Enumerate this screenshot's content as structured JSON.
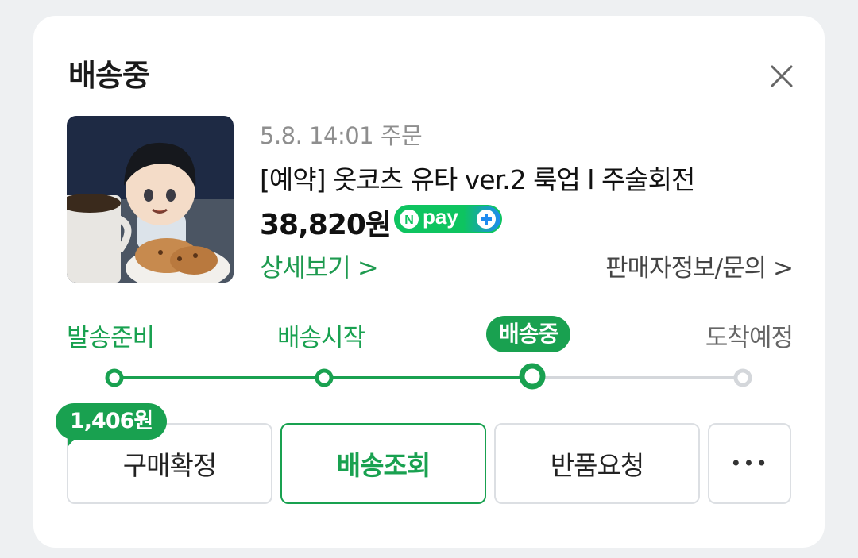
{
  "card": {
    "title": "배송중",
    "close_icon": "close-icon"
  },
  "product": {
    "image_description_icon": "product-thumbnail",
    "order_date": "5.8. 14:01 주문",
    "name": "[예약] 옷코츠 유타 ver.2 룩업 l 주술회전",
    "price": "38,820원",
    "npay_label": "pay"
  },
  "links": {
    "detail": "상세보기 >",
    "seller": "판매자정보/문의 >"
  },
  "progress": {
    "steps": [
      "발송준비",
      "배송시작",
      "배송중",
      "도착예정"
    ],
    "current_index": 2,
    "colors": {
      "done": "#19a150",
      "pending": "#d4d7db"
    }
  },
  "actions": {
    "reward_badge": "1,406원",
    "confirm_purchase": "구매확정",
    "track_delivery": "배송조회",
    "return_request": "반품요청",
    "more": "•••"
  }
}
